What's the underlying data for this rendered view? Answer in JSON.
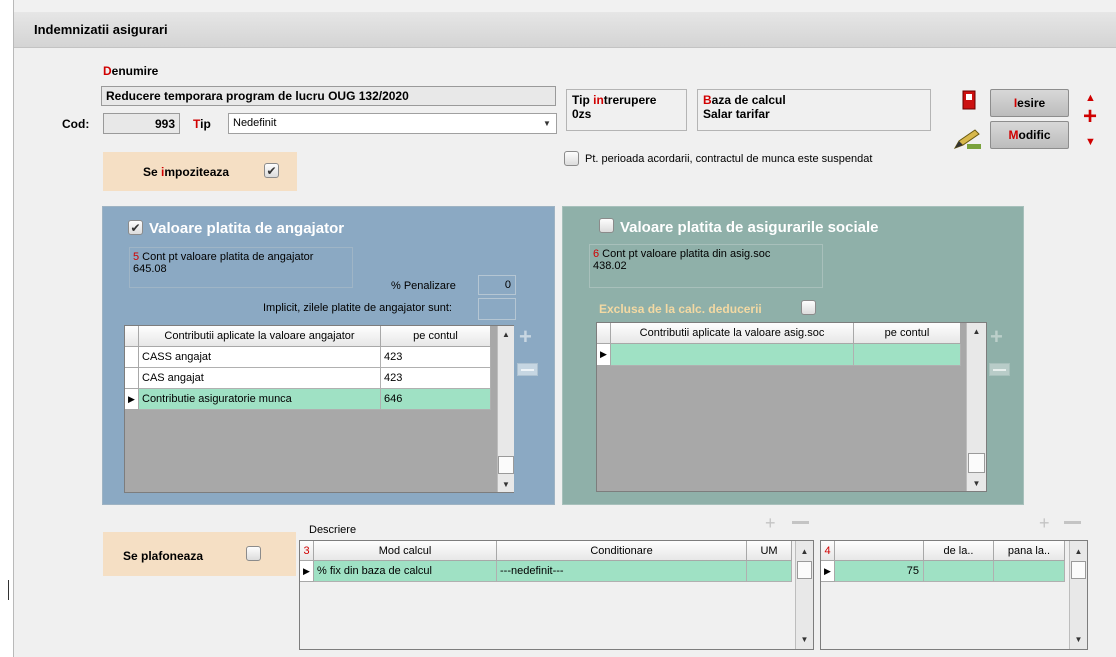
{
  "window": {
    "title": "Indemnizatii asigurari"
  },
  "header": {
    "denumire_label_first": "D",
    "denumire_label_rest": "enumire",
    "denumire_value": "Reducere temporara program de lucru OUG 132/2020",
    "cod_label": "Cod:",
    "cod_value": "993",
    "tip_label_first": "T",
    "tip_label_rest": "ip",
    "tip_value": "Nedefinit",
    "tip_intrerupere_label_a": "Tip ",
    "tip_intrerupere_label_b": "in",
    "tip_intrerupere_label_c": "trerupere",
    "tip_intrerupere_value": "0zs",
    "baza_label_first": "B",
    "baza_label_rest": "aza de calcul",
    "baza_value": "Salar tarifar"
  },
  "buttons": {
    "iesire_first": "I",
    "iesire_rest": "esire",
    "modific_first": "M",
    "modific_rest": "odific"
  },
  "impozitare": {
    "label_a": "Se ",
    "label_b": "i",
    "label_c": "mpoziteaza",
    "checked": true
  },
  "suspendat": {
    "label": "Pt. perioada acordarii, contractul de munca este suspendat"
  },
  "angajator": {
    "title": "Valoare platita de angajator",
    "cont_num": "5",
    "cont_label": " Cont pt valoare platita de angajator",
    "cont_value": "645.08",
    "penalizare_label": "% Penalizare",
    "penalizare_value": "0",
    "implicit_label": "Implicit, zilele platite de angajator sunt:",
    "columns": [
      "Contributii aplicate la valoare angajator",
      "pe contul"
    ],
    "rows": [
      {
        "name": "CASS angajat",
        "cont": "423"
      },
      {
        "name": "CAS angajat",
        "cont": "423"
      },
      {
        "name": "Contributie asiguratorie munca",
        "cont": "646"
      }
    ]
  },
  "asigurari": {
    "title": "Valoare platita de asigurarile sociale",
    "cont_num": "6",
    "cont_label": " Cont pt valoare platita din asig.soc",
    "cont_value": "438.02",
    "exclusa_label": "Exclusa de la calc. deducerii",
    "columns": [
      "Contributii aplicate la valoare asig.soc",
      "pe contul"
    ]
  },
  "plafonare": {
    "label": "Se plafoneaza",
    "descriere_label": "Descriere",
    "grid3_num": "3",
    "grid3_columns": [
      "Mod calcul",
      "Conditionare",
      "UM"
    ],
    "grid3_row": {
      "mod": "% fix din baza de calcul",
      "cond": "---nedefinit---",
      "um": ""
    },
    "grid4_num": "4",
    "grid4_columns": [
      "",
      "de la..",
      "pana la.."
    ],
    "grid4_row": {
      "val": "75",
      "de": "",
      "pana": ""
    }
  },
  "colors": {
    "angajator_panel": "#8ba9c3",
    "asig_panel": "#8fb0a9",
    "peach": "#f5dfc4",
    "red": "#d00000"
  }
}
